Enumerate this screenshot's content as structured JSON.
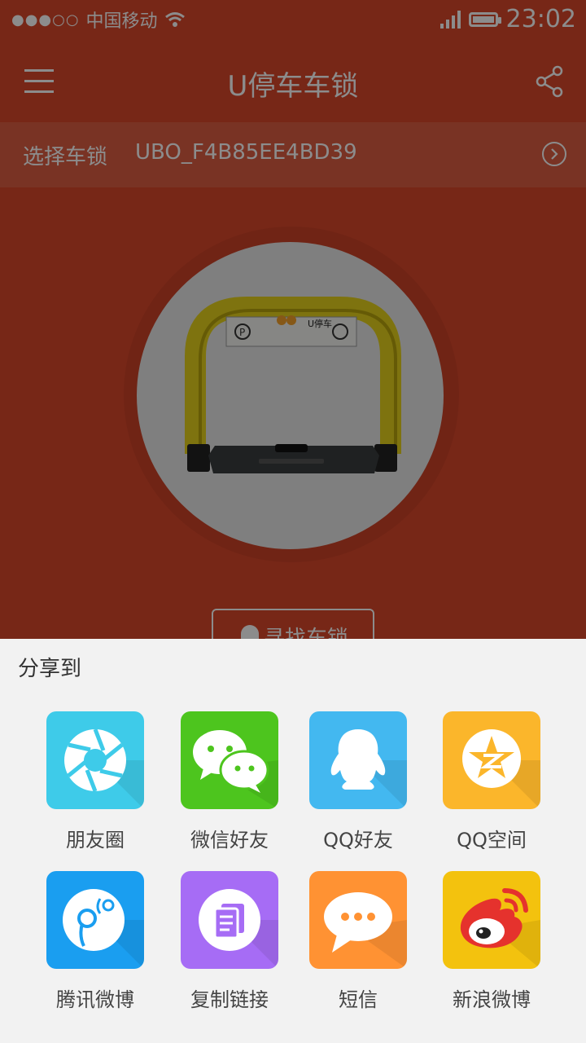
{
  "status_bar": {
    "carrier": "中国移动",
    "signal_dots": "●●●○○",
    "time": "23:02"
  },
  "header": {
    "title": "U停车车锁"
  },
  "lock_selector": {
    "label": "选择车锁",
    "value": "UBO_F4B85EE4BD39"
  },
  "lock_image": {
    "brand": "U停车"
  },
  "find_button": {
    "label": "寻找车锁"
  },
  "share_sheet": {
    "title": "分享到",
    "items": [
      {
        "label": "朋友圈",
        "icon": "moments-icon",
        "color": "#3ecbe9"
      },
      {
        "label": "微信好友",
        "icon": "wechat-icon",
        "color": "#4dc51e"
      },
      {
        "label": "QQ好友",
        "icon": "qq-icon",
        "color": "#43b8f0"
      },
      {
        "label": "QQ空间",
        "icon": "qzone-icon",
        "color": "#fbb62b"
      },
      {
        "label": "腾讯微博",
        "icon": "tencent-weibo-icon",
        "color": "#1a9ef0"
      },
      {
        "label": "复制链接",
        "icon": "copy-link-icon",
        "color": "#a66cf5"
      },
      {
        "label": "短信",
        "icon": "sms-icon",
        "color": "#ff9233"
      },
      {
        "label": "新浪微博",
        "icon": "sina-weibo-icon",
        "color": "#f3c20e"
      }
    ]
  }
}
